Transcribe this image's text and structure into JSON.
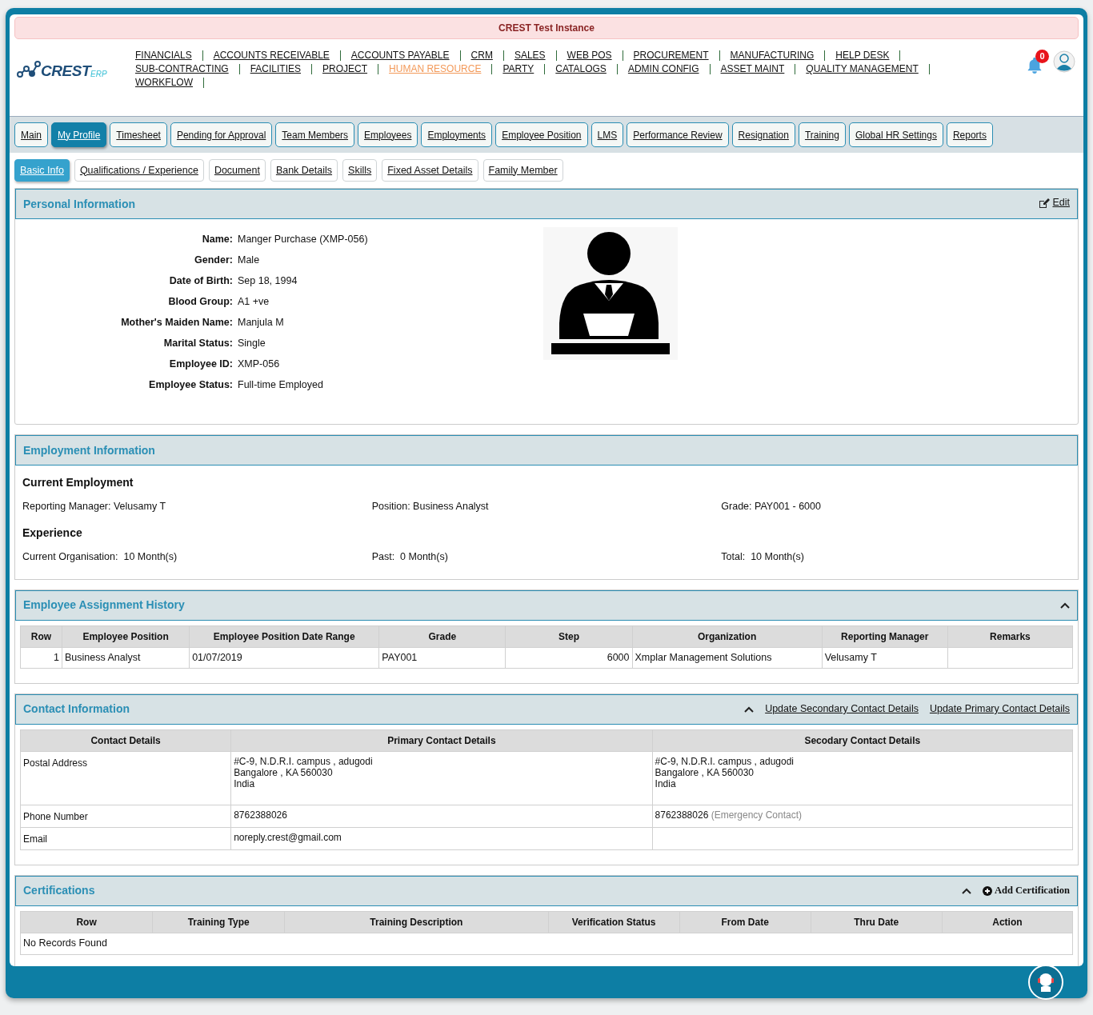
{
  "banner": {
    "text": "CREST Test Instance"
  },
  "logo": {
    "text": "CREST",
    "suffix": "ERP"
  },
  "nav_menu": [
    {
      "label": "FINANCIALS",
      "selected": false
    },
    {
      "label": "ACCOUNTS RECEIVABLE",
      "selected": false
    },
    {
      "label": "ACCOUNTS PAYABLE",
      "selected": false
    },
    {
      "label": "CRM",
      "selected": false
    },
    {
      "label": "SALES",
      "selected": false
    },
    {
      "label": "WEB POS",
      "selected": false
    },
    {
      "label": "PROCUREMENT",
      "selected": false
    },
    {
      "label": "MANUFACTURING",
      "selected": false
    },
    {
      "label": "HELP DESK",
      "selected": false
    },
    {
      "label": "SUB-CONTRACTING",
      "selected": false
    },
    {
      "label": "FACILITIES",
      "selected": false
    },
    {
      "label": "PROJECT",
      "selected": false
    },
    {
      "label": "HUMAN RESOURCE",
      "selected": true
    },
    {
      "label": "PARTY",
      "selected": false
    },
    {
      "label": "CATALOGS",
      "selected": false
    },
    {
      "label": "ADMIN CONFIG",
      "selected": false
    },
    {
      "label": "ASSET MAINT",
      "selected": false
    },
    {
      "label": "QUALITY MANAGEMENT",
      "selected": false
    },
    {
      "label": "WORKFLOW",
      "selected": false
    }
  ],
  "notifications": {
    "count": "0"
  },
  "module_tabs": [
    {
      "label": "Main",
      "selected": false
    },
    {
      "label": "My Profile",
      "selected": true
    },
    {
      "label": "Timesheet",
      "selected": false
    },
    {
      "label": "Pending for Approval",
      "selected": false
    },
    {
      "label": "Team Members",
      "selected": false
    },
    {
      "label": "Employees",
      "selected": false
    },
    {
      "label": "Employments",
      "selected": false
    },
    {
      "label": "Employee Position",
      "selected": false
    },
    {
      "label": "LMS",
      "selected": false
    },
    {
      "label": "Performance Review",
      "selected": false
    },
    {
      "label": "Resignation",
      "selected": false
    },
    {
      "label": "Training",
      "selected": false
    },
    {
      "label": "Global HR Settings",
      "selected": false
    },
    {
      "label": "Reports",
      "selected": false
    }
  ],
  "sub_tabs": [
    {
      "label": "Basic Info",
      "selected": true
    },
    {
      "label": "Qualifications / Experience",
      "selected": false
    },
    {
      "label": "Document",
      "selected": false
    },
    {
      "label": "Bank Details",
      "selected": false
    },
    {
      "label": "Skills",
      "selected": false
    },
    {
      "label": "Fixed Asset Details",
      "selected": false
    },
    {
      "label": "Family Member",
      "selected": false
    }
  ],
  "personal_information": {
    "title": "Personal Information",
    "edit_label": "Edit",
    "fields": [
      {
        "label": "Name:",
        "value": "Manger Purchase (XMP-056)"
      },
      {
        "label": "Gender:",
        "value": "Male"
      },
      {
        "label": "Date of Birth:",
        "value": "Sep 18, 1994"
      },
      {
        "label": "Blood Group:",
        "value": "A1 +ve"
      },
      {
        "label": "Mother's Maiden Name:",
        "value": "Manjula M"
      },
      {
        "label": "Marital Status:",
        "value": "Single"
      },
      {
        "label": "Employee ID:",
        "value": "XMP-056"
      },
      {
        "label": "Employee Status:",
        "value": "Full-time Employed"
      }
    ]
  },
  "employment_information": {
    "title": "Employment Information",
    "current_heading": "Current Employment",
    "current": [
      {
        "label": "Reporting Manager:",
        "value": "Velusamy T"
      },
      {
        "label": "Position:",
        "value": "Business Analyst"
      },
      {
        "label": "Grade:",
        "value": "PAY001 - 6000"
      }
    ],
    "experience_heading": "Experience",
    "experience": [
      {
        "label": "Current Organisation:",
        "value": "10 Month(s)"
      },
      {
        "label": "Past:",
        "value": "0 Month(s)"
      },
      {
        "label": "Total:",
        "value": "10 Month(s)"
      }
    ]
  },
  "assignment_history": {
    "title": "Employee Assignment History",
    "expanded": true,
    "columns": [
      "Row",
      "Employee Position",
      "Employee Position Date Range",
      "Grade",
      "Step",
      "Organization",
      "Reporting Manager",
      "Remarks"
    ],
    "rows": [
      [
        "1",
        "Business Analyst",
        "01/07/2019",
        "PAY001",
        "6000",
        "Xmplar Management Solutions",
        "Velusamy T",
        ""
      ]
    ]
  },
  "contact_information": {
    "title": "Contact Information",
    "expanded": true,
    "links": [
      "Update Secondary Contact Details",
      "Update Primary Contact Details"
    ],
    "columns": [
      "Contact Details",
      "Primary Contact Details",
      "Secodary Contact Details"
    ],
    "rows": [
      {
        "kind": "address",
        "label": "Postal Address",
        "primary": [
          "#C-9, N.D.R.I. campus , adugodi",
          "Bangalore , KA 560030",
          "India"
        ],
        "secondary": [
          "#C-9, N.D.R.I. campus , adugodi",
          "Bangalore , KA 560030",
          "India"
        ]
      },
      {
        "kind": "phone",
        "label": "Phone Number",
        "primary": [
          "8762388026"
        ],
        "secondary": [
          "8762388026"
        ],
        "secondary_note": "(Emergency Contact)"
      },
      {
        "kind": "email",
        "label": "Email",
        "primary": [
          "noreply.crest@gmail.com"
        ],
        "secondary": []
      }
    ]
  },
  "certifications": {
    "title": "Certifications",
    "expanded": true,
    "add_label": "Add Certification",
    "columns": [
      "Row",
      "Training Type",
      "Training Description",
      "Verification Status",
      "From Date",
      "Thru Date",
      "Action"
    ],
    "empty_text": "No Records Found"
  }
}
